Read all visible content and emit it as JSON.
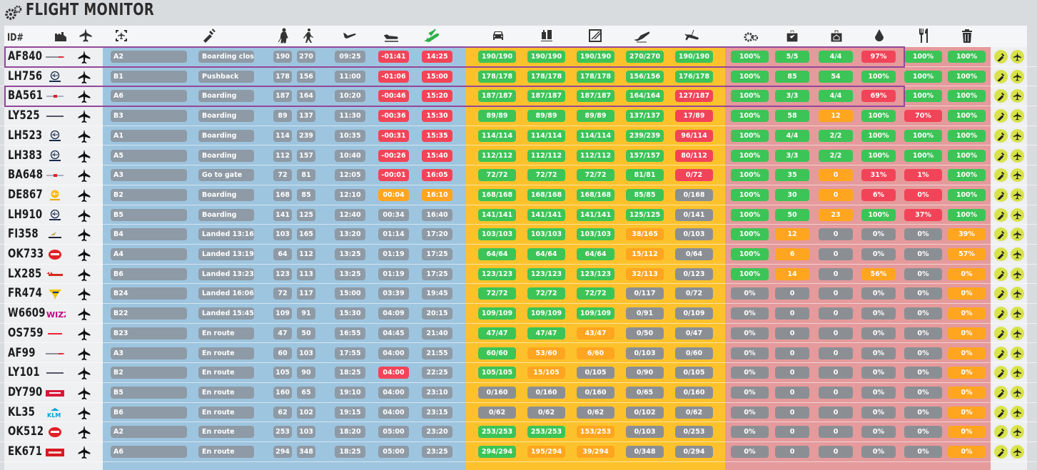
{
  "app": {
    "title": "FLIGHT MONITOR"
  },
  "header": {
    "id_label": "ID#"
  },
  "colors": {
    "green": "#3cc457",
    "red": "#f24458",
    "orange": "#ffa51f",
    "grey": "#8b8f94",
    "blue_band": "#9ec5df",
    "yellow_band": "#fdc22b",
    "pink_band": "#e59a9c",
    "highlight": "#93479a"
  },
  "header_icons": [
    "hangar-icon",
    "aircraft-stand-icon",
    "gate-icon",
    "pushback-icon",
    "boarding-passenger-icon",
    "walking-passenger-icon",
    "takeoff-icon",
    "landing-icon",
    "check-landing-icon",
    "car-icon",
    "baggage-cart-icon",
    "cargo-icon",
    "departing-plane-icon",
    "arriving-plane-icon",
    "gear-icon",
    "bag-icon",
    "catering-bag-icon",
    "fuel-icon",
    "fork-knife-icon",
    "trash-icon"
  ],
  "flights": [
    {
      "id": "AF840",
      "airline": "af",
      "gate": "A2",
      "status": "Boarding closed",
      "n1": "190",
      "n2": "270",
      "std": "09:25",
      "delay": "-01:41",
      "delay_c": "r",
      "etd": "14:25",
      "etd_c": "r",
      "pax": [
        [
          "190/190",
          "g"
        ],
        [
          "190/190",
          "g"
        ],
        [
          "190/190",
          "g"
        ],
        [
          "270/270",
          "g"
        ],
        [
          "190/190",
          "g"
        ]
      ],
      "svc": [
        [
          "100%",
          "g"
        ],
        [
          "5/5",
          "g"
        ],
        [
          "4/4",
          "g"
        ],
        [
          "97%",
          "r"
        ],
        [
          "100%",
          "g"
        ],
        [
          "100%",
          "g"
        ]
      ],
      "hl": true
    },
    {
      "id": "LH756",
      "airline": "lh",
      "gate": "B1",
      "status": "Pushback",
      "n1": "178",
      "n2": "156",
      "std": "11:00",
      "delay": "-01:06",
      "delay_c": "r",
      "etd": "15:00",
      "etd_c": "r",
      "pax": [
        [
          "178/178",
          "g"
        ],
        [
          "178/178",
          "g"
        ],
        [
          "178/178",
          "g"
        ],
        [
          "156/156",
          "g"
        ],
        [
          "176/178",
          "g"
        ]
      ],
      "svc": [
        [
          "100%",
          "g"
        ],
        [
          "85",
          "g"
        ],
        [
          "54",
          "g"
        ],
        [
          "100%",
          "g"
        ],
        [
          "100%",
          "g"
        ],
        [
          "100%",
          "g"
        ]
      ]
    },
    {
      "id": "BA561",
      "airline": "ba",
      "gate": "A6",
      "status": "Boarding",
      "n1": "187",
      "n2": "164",
      "std": "10:20",
      "delay": "-00:46",
      "delay_c": "r",
      "etd": "15:20",
      "etd_c": "r",
      "pax": [
        [
          "187/187",
          "g"
        ],
        [
          "187/187",
          "g"
        ],
        [
          "187/187",
          "g"
        ],
        [
          "164/164",
          "g"
        ],
        [
          "127/187",
          "r"
        ]
      ],
      "svc": [
        [
          "100%",
          "g"
        ],
        [
          "3/3",
          "g"
        ],
        [
          "4/4",
          "g"
        ],
        [
          "69%",
          "r"
        ],
        [
          "100%",
          "g"
        ],
        [
          "100%",
          "g"
        ]
      ],
      "hl": true
    },
    {
      "id": "LY525",
      "airline": "ly",
      "gate": "B3",
      "status": "Boarding",
      "n1": "89",
      "n2": "137",
      "std": "11:30",
      "delay": "-00:36",
      "delay_c": "r",
      "etd": "15:30",
      "etd_c": "r",
      "pax": [
        [
          "89/89",
          "g"
        ],
        [
          "89/89",
          "g"
        ],
        [
          "89/89",
          "g"
        ],
        [
          "137/137",
          "g"
        ],
        [
          "17/89",
          "r"
        ]
      ],
      "svc": [
        [
          "100%",
          "g"
        ],
        [
          "58",
          "g"
        ],
        [
          "12",
          "o"
        ],
        [
          "100%",
          "g"
        ],
        [
          "70%",
          "r"
        ],
        [
          "100%",
          "g"
        ]
      ]
    },
    {
      "id": "LH523",
      "airline": "lh",
      "gate": "A1",
      "status": "Boarding",
      "n1": "114",
      "n2": "239",
      "std": "10:35",
      "delay": "-00:31",
      "delay_c": "r",
      "etd": "15:35",
      "etd_c": "r",
      "pax": [
        [
          "114/114",
          "g"
        ],
        [
          "114/114",
          "g"
        ],
        [
          "114/114",
          "g"
        ],
        [
          "239/239",
          "g"
        ],
        [
          "96/114",
          "r"
        ]
      ],
      "svc": [
        [
          "100%",
          "g"
        ],
        [
          "4/4",
          "g"
        ],
        [
          "2/2",
          "g"
        ],
        [
          "100%",
          "g"
        ],
        [
          "100%",
          "g"
        ],
        [
          "100%",
          "g"
        ]
      ]
    },
    {
      "id": "LH383",
      "airline": "lh",
      "gate": "A5",
      "status": "Boarding",
      "n1": "112",
      "n2": "157",
      "std": "10:40",
      "delay": "-00:26",
      "delay_c": "r",
      "etd": "15:40",
      "etd_c": "r",
      "pax": [
        [
          "112/112",
          "g"
        ],
        [
          "112/112",
          "g"
        ],
        [
          "112/112",
          "g"
        ],
        [
          "157/157",
          "g"
        ],
        [
          "80/112",
          "r"
        ]
      ],
      "svc": [
        [
          "100%",
          "g"
        ],
        [
          "3/3",
          "g"
        ],
        [
          "2/2",
          "g"
        ],
        [
          "100%",
          "g"
        ],
        [
          "100%",
          "g"
        ],
        [
          "100%",
          "g"
        ]
      ]
    },
    {
      "id": "BA648",
      "airline": "ba",
      "gate": "A3",
      "status": "Go to gate",
      "n1": "72",
      "n2": "81",
      "std": "12:05",
      "delay": "-00:01",
      "delay_c": "r",
      "etd": "16:05",
      "etd_c": "r",
      "pax": [
        [
          "72/72",
          "g"
        ],
        [
          "72/72",
          "g"
        ],
        [
          "72/72",
          "g"
        ],
        [
          "81/81",
          "g"
        ],
        [
          "0/72",
          "r"
        ]
      ],
      "svc": [
        [
          "100%",
          "g"
        ],
        [
          "35",
          "g"
        ],
        [
          "0",
          "o"
        ],
        [
          "31%",
          "r"
        ],
        [
          "1%",
          "r"
        ],
        [
          "100%",
          "g"
        ]
      ]
    },
    {
      "id": "DE867",
      "airline": "de",
      "gate": "B2",
      "status": "Boarding",
      "n1": "168",
      "n2": "85",
      "std": "12:10",
      "delay": "00:04",
      "delay_c": "o",
      "etd": "16:10",
      "etd_c": "o",
      "pax": [
        [
          "168/168",
          "g"
        ],
        [
          "168/168",
          "g"
        ],
        [
          "168/168",
          "g"
        ],
        [
          "85/85",
          "g"
        ],
        [
          "0/168",
          "k"
        ]
      ],
      "svc": [
        [
          "100%",
          "g"
        ],
        [
          "30",
          "g"
        ],
        [
          "0",
          "o"
        ],
        [
          "6%",
          "r"
        ],
        [
          "0%",
          "r"
        ],
        [
          "100%",
          "g"
        ]
      ]
    },
    {
      "id": "LH910",
      "airline": "lh",
      "gate": "B5",
      "status": "Boarding",
      "n1": "141",
      "n2": "125",
      "std": "12:40",
      "delay": "00:34",
      "delay_c": "s",
      "etd": "16:40",
      "etd_c": "s",
      "pax": [
        [
          "141/141",
          "g"
        ],
        [
          "141/141",
          "g"
        ],
        [
          "141/141",
          "g"
        ],
        [
          "125/125",
          "g"
        ],
        [
          "0/141",
          "k"
        ]
      ],
      "svc": [
        [
          "100%",
          "g"
        ],
        [
          "50",
          "g"
        ],
        [
          "23",
          "o"
        ],
        [
          "100%",
          "g"
        ],
        [
          "37%",
          "r"
        ],
        [
          "100%",
          "g"
        ]
      ]
    },
    {
      "id": "FI358",
      "airline": "fi",
      "gate": "B4",
      "status": "Landed  13:16",
      "n1": "103",
      "n2": "165",
      "std": "13:20",
      "delay": "01:14",
      "delay_c": "s",
      "etd": "17:20",
      "etd_c": "s",
      "pax": [
        [
          "103/103",
          "g"
        ],
        [
          "103/103",
          "g"
        ],
        [
          "103/103",
          "g"
        ],
        [
          "38/165",
          "o"
        ],
        [
          "0/103",
          "k"
        ]
      ],
      "svc": [
        [
          "100%",
          "g"
        ],
        [
          "12",
          "o"
        ],
        [
          "0",
          "k"
        ],
        [
          "0%",
          "k"
        ],
        [
          "0%",
          "k"
        ],
        [
          "39%",
          "o"
        ]
      ]
    },
    {
      "id": "OK733",
      "airline": "ok",
      "gate": "A4",
      "status": "Landed  13:19",
      "n1": "64",
      "n2": "112",
      "std": "13:25",
      "delay": "01:19",
      "delay_c": "s",
      "etd": "17:25",
      "etd_c": "s",
      "pax": [
        [
          "64/64",
          "g"
        ],
        [
          "64/64",
          "g"
        ],
        [
          "64/64",
          "g"
        ],
        [
          "15/112",
          "o"
        ],
        [
          "0/64",
          "k"
        ]
      ],
      "svc": [
        [
          "100%",
          "g"
        ],
        [
          "6",
          "o"
        ],
        [
          "0",
          "k"
        ],
        [
          "0%",
          "k"
        ],
        [
          "0%",
          "k"
        ],
        [
          "57%",
          "o"
        ]
      ]
    },
    {
      "id": "LX285",
      "airline": "lx",
      "gate": "B6",
      "status": "Landed  13:23",
      "n1": "123",
      "n2": "113",
      "std": "13:25",
      "delay": "01:19",
      "delay_c": "s",
      "etd": "17:25",
      "etd_c": "s",
      "pax": [
        [
          "123/123",
          "g"
        ],
        [
          "123/123",
          "g"
        ],
        [
          "123/123",
          "g"
        ],
        [
          "32/113",
          "o"
        ],
        [
          "0/123",
          "k"
        ]
      ],
      "svc": [
        [
          "100%",
          "g"
        ],
        [
          "14",
          "o"
        ],
        [
          "0",
          "k"
        ],
        [
          "56%",
          "o"
        ],
        [
          "0%",
          "k"
        ],
        [
          "0%",
          "o"
        ]
      ]
    },
    {
      "id": "FR474",
      "airline": "fr",
      "gate": "B24",
      "status": "Landed  16:06",
      "n1": "72",
      "n2": "117",
      "std": "15:00",
      "delay": "03:39",
      "delay_c": "s",
      "etd": "19:45",
      "etd_c": "s",
      "pax": [
        [
          "72/72",
          "g"
        ],
        [
          "72/72",
          "g"
        ],
        [
          "72/72",
          "g"
        ],
        [
          "0/117",
          "k"
        ],
        [
          "0/72",
          "k"
        ]
      ],
      "svc": [
        [
          "0%",
          "k"
        ],
        [
          "0",
          "k"
        ],
        [
          "0",
          "k"
        ],
        [
          "0%",
          "k"
        ],
        [
          "0%",
          "k"
        ],
        [
          "0%",
          "o"
        ]
      ]
    },
    {
      "id": "W6609",
      "airline": "w6",
      "gate": "B22",
      "status": "Landed  15:45",
      "n1": "109",
      "n2": "91",
      "std": "15:30",
      "delay": "04:09",
      "delay_c": "s",
      "etd": "20:15",
      "etd_c": "s",
      "pax": [
        [
          "109/109",
          "g"
        ],
        [
          "109/109",
          "g"
        ],
        [
          "109/109",
          "g"
        ],
        [
          "0/91",
          "k"
        ],
        [
          "0/109",
          "k"
        ]
      ],
      "svc": [
        [
          "0%",
          "k"
        ],
        [
          "0",
          "k"
        ],
        [
          "0",
          "k"
        ],
        [
          "0%",
          "k"
        ],
        [
          "0%",
          "k"
        ],
        [
          "0%",
          "o"
        ]
      ]
    },
    {
      "id": "OS759",
      "airline": "os",
      "gate": "B23",
      "status": "En route",
      "n1": "47",
      "n2": "50",
      "std": "16:55",
      "delay": "04:45",
      "delay_c": "s",
      "etd": "21:40",
      "etd_c": "s",
      "pax": [
        [
          "47/47",
          "g"
        ],
        [
          "47/47",
          "g"
        ],
        [
          "43/47",
          "o"
        ],
        [
          "0/50",
          "k"
        ],
        [
          "0/47",
          "k"
        ]
      ],
      "svc": [
        [
          "0%",
          "k"
        ],
        [
          "0",
          "k"
        ],
        [
          "0",
          "k"
        ],
        [
          "0%",
          "k"
        ],
        [
          "0%",
          "k"
        ],
        [
          "0%",
          "o"
        ]
      ]
    },
    {
      "id": "AF99",
      "airline": "af",
      "gate": "A3",
      "status": "En route",
      "n1": "60",
      "n2": "103",
      "std": "17:55",
      "delay": "04:00",
      "delay_c": "s",
      "etd": "21:55",
      "etd_c": "s",
      "pax": [
        [
          "60/60",
          "g"
        ],
        [
          "53/60",
          "o"
        ],
        [
          "6/60",
          "o"
        ],
        [
          "0/103",
          "k"
        ],
        [
          "0/60",
          "k"
        ]
      ],
      "svc": [
        [
          "0%",
          "k"
        ],
        [
          "0",
          "k"
        ],
        [
          "0",
          "k"
        ],
        [
          "0%",
          "k"
        ],
        [
          "0%",
          "k"
        ],
        [
          "0%",
          "o"
        ]
      ]
    },
    {
      "id": "LY101",
      "airline": "ly",
      "gate": "B2",
      "status": "En route",
      "n1": "105",
      "n2": "90",
      "std": "18:25",
      "delay": "04:00",
      "delay_c": "r",
      "etd": "22:25",
      "etd_c": "s",
      "pax": [
        [
          "105/105",
          "g"
        ],
        [
          "15/105",
          "o"
        ],
        [
          "0/105",
          "k"
        ],
        [
          "0/90",
          "k"
        ],
        [
          "0/105",
          "k"
        ]
      ],
      "svc": [
        [
          "0%",
          "k"
        ],
        [
          "0",
          "k"
        ],
        [
          "0",
          "k"
        ],
        [
          "0%",
          "k"
        ],
        [
          "0%",
          "k"
        ],
        [
          "0%",
          "o"
        ]
      ]
    },
    {
      "id": "DY790",
      "airline": "dy",
      "gate": "B5",
      "status": "En route",
      "n1": "160",
      "n2": "65",
      "std": "19:10",
      "delay": "04:00",
      "delay_c": "s",
      "etd": "23:10",
      "etd_c": "s",
      "pax": [
        [
          "0/160",
          "k"
        ],
        [
          "0/160",
          "k"
        ],
        [
          "0/160",
          "k"
        ],
        [
          "0/65",
          "k"
        ],
        [
          "0/160",
          "k"
        ]
      ],
      "svc": [
        [
          "0%",
          "k"
        ],
        [
          "0",
          "k"
        ],
        [
          "0",
          "k"
        ],
        [
          "0%",
          "k"
        ],
        [
          "0%",
          "k"
        ],
        [
          "0%",
          "o"
        ]
      ]
    },
    {
      "id": "KL35",
      "airline": "kl",
      "gate": "B6",
      "status": "En route",
      "n1": "62",
      "n2": "102",
      "std": "19:15",
      "delay": "04:00",
      "delay_c": "s",
      "etd": "23:15",
      "etd_c": "s",
      "pax": [
        [
          "0/62",
          "k"
        ],
        [
          "0/62",
          "k"
        ],
        [
          "0/62",
          "k"
        ],
        [
          "0/102",
          "k"
        ],
        [
          "0/62",
          "k"
        ]
      ],
      "svc": [
        [
          "0%",
          "k"
        ],
        [
          "0",
          "k"
        ],
        [
          "0",
          "k"
        ],
        [
          "0%",
          "k"
        ],
        [
          "0%",
          "k"
        ],
        [
          "0%",
          "o"
        ]
      ]
    },
    {
      "id": "OK512",
      "airline": "ok",
      "gate": "A2",
      "status": "En route",
      "n1": "253",
      "n2": "103",
      "std": "18:20",
      "delay": "05:00",
      "delay_c": "s",
      "etd": "23:20",
      "etd_c": "s",
      "pax": [
        [
          "253/253",
          "g"
        ],
        [
          "253/253",
          "g"
        ],
        [
          "153/253",
          "o"
        ],
        [
          "0/103",
          "k"
        ],
        [
          "0/253",
          "k"
        ]
      ],
      "svc": [
        [
          "0%",
          "k"
        ],
        [
          "0",
          "k"
        ],
        [
          "0",
          "k"
        ],
        [
          "0%",
          "k"
        ],
        [
          "0%",
          "k"
        ],
        [
          "0%",
          "o"
        ]
      ]
    },
    {
      "id": "EK671",
      "airline": "ek",
      "gate": "A6",
      "status": "En route",
      "n1": "294",
      "n2": "348",
      "std": "18:25",
      "delay": "05:00",
      "delay_c": "s",
      "etd": "23:25",
      "etd_c": "s",
      "pax": [
        [
          "294/294",
          "g"
        ],
        [
          "195/294",
          "o"
        ],
        [
          "39/294",
          "o"
        ],
        [
          "0/348",
          "k"
        ],
        [
          "0/294",
          "k"
        ]
      ],
      "svc": [
        [
          "0%",
          "k"
        ],
        [
          "0",
          "k"
        ],
        [
          "0",
          "k"
        ],
        [
          "0%",
          "k"
        ],
        [
          "0%",
          "k"
        ],
        [
          "0%",
          "o"
        ]
      ]
    }
  ]
}
